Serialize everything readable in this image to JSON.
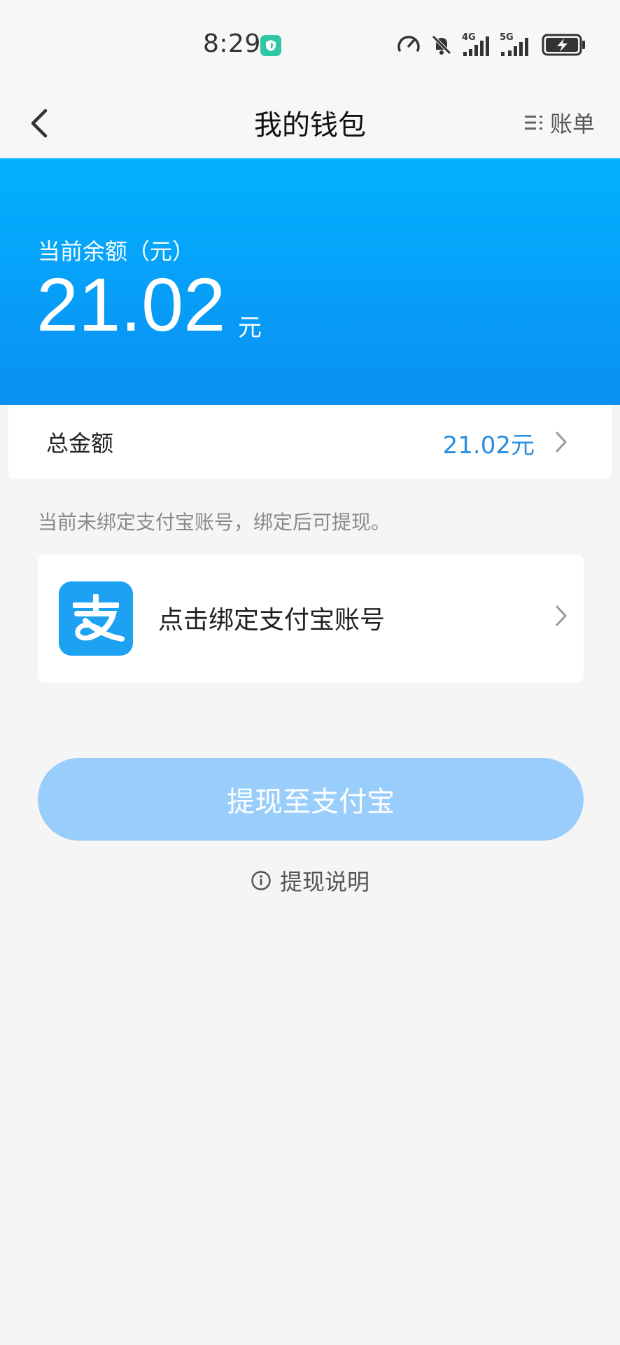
{
  "status_bar": {
    "time": "8:29",
    "network_1": "4G",
    "network_2": "5G"
  },
  "header": {
    "title": "我的钱包",
    "bill_label": "账单"
  },
  "balance": {
    "label": "当前余额（元）",
    "amount": "21.02",
    "unit": "元"
  },
  "total": {
    "label": "总金额",
    "value": "21.02元"
  },
  "hint": "当前未绑定支付宝账号，绑定后可提现。",
  "alipay": {
    "logo_char": "支",
    "bind_label": "点击绑定支付宝账号"
  },
  "withdraw": {
    "button_label": "提现至支付宝",
    "info_label": "提现说明"
  },
  "colors": {
    "brand_blue": "#03b1ff",
    "accent_blue": "#2a8fe0",
    "button_disabled": "#99cdfb",
    "alipay_blue": "#1da1f2"
  }
}
